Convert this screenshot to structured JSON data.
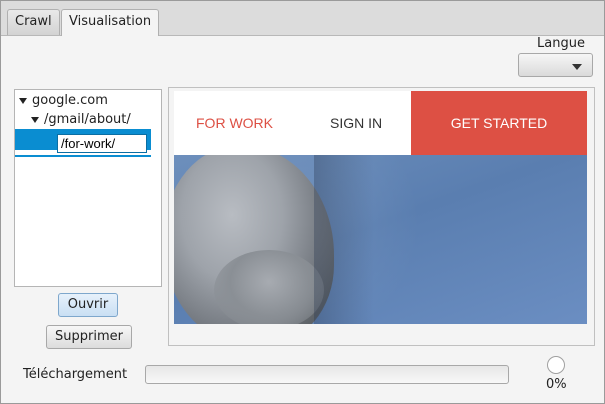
{
  "tabs": [
    {
      "label": "Crawl"
    },
    {
      "label": "Visualisation"
    }
  ],
  "language": {
    "label": "Langue",
    "selected": ""
  },
  "tree": {
    "root": "google.com",
    "child": "/gmail/about/",
    "editing": "/for-work/"
  },
  "buttons": {
    "open": "Ouvrir",
    "delete": "Supprimer"
  },
  "webpage": {
    "nav": {
      "for_work": "FOR WORK",
      "sign_in": "SIGN IN",
      "get_started": "GET STARTED"
    },
    "colors": {
      "accent": "#dd5044",
      "for_work_text": "#dd5044"
    }
  },
  "download": {
    "label": "Téléchargement",
    "progress": 0,
    "percent_text": "0%"
  },
  "colors": {
    "selection": "#0a8dd1"
  }
}
